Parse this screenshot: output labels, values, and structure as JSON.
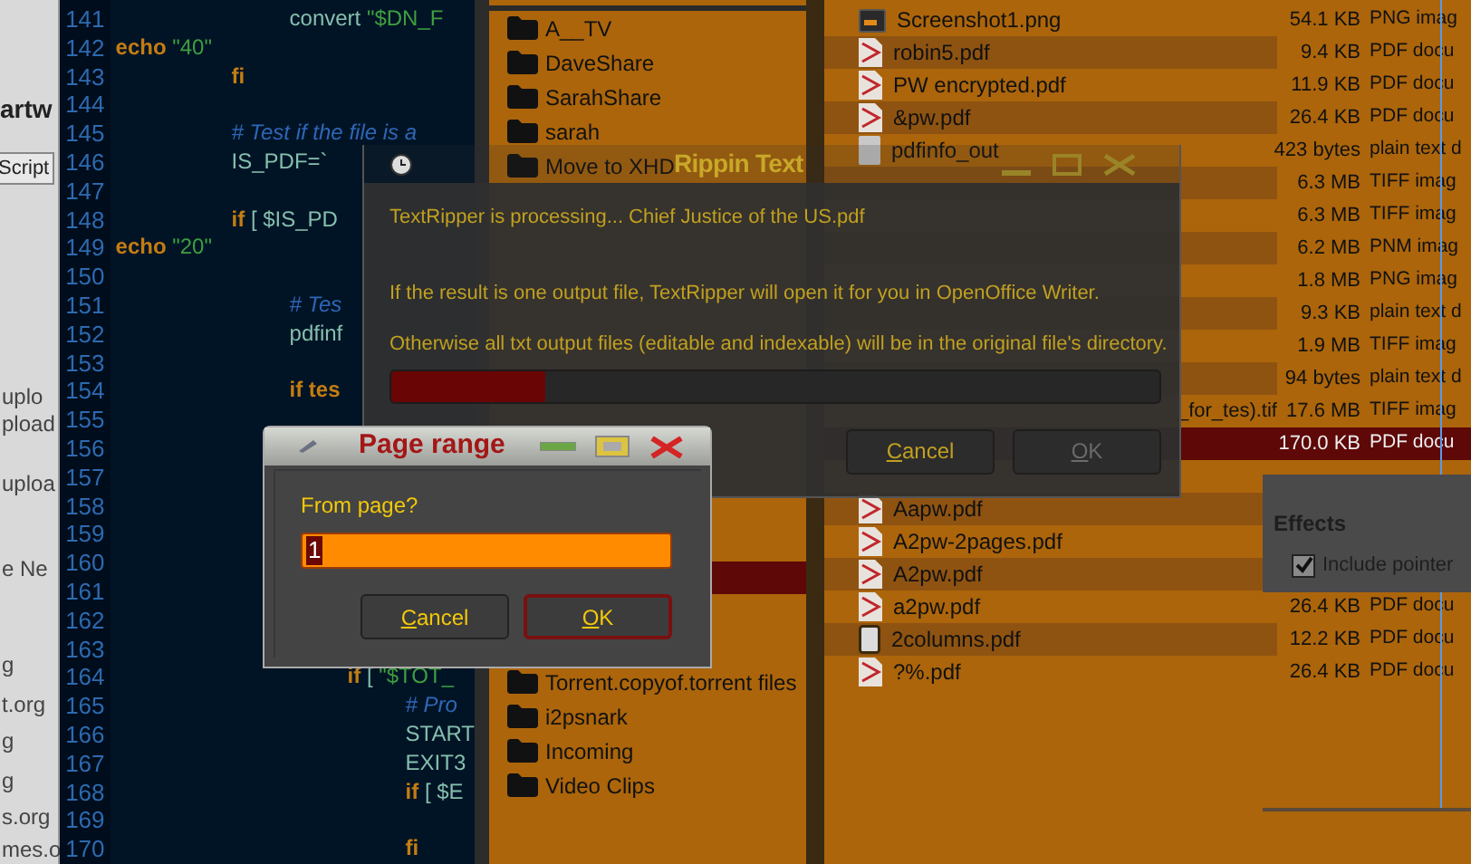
{
  "browser_window": {
    "heading": "artw",
    "button": "Script",
    "fragments": [
      "uplo",
      "pload",
      "uploa",
      "e Ne",
      "g",
      "t.org",
      "g",
      "g",
      "s.org",
      "mes.o"
    ]
  },
  "editor": {
    "lines": [
      {
        "number": "141",
        "tokens": [
          {
            "kind": "plain",
            "text": "\t\t\tconvert "
          },
          {
            "kind": "string",
            "text": "\"$DN_F"
          }
        ]
      },
      {
        "number": "142",
        "tokens": [
          {
            "kind": "keyword",
            "text": "echo "
          },
          {
            "kind": "string",
            "text": "\"40\""
          }
        ]
      },
      {
        "number": "143",
        "tokens": [
          {
            "kind": "keyword",
            "text": "\t\tfi"
          }
        ]
      },
      {
        "number": "144"
      },
      {
        "number": "145",
        "tokens": [
          {
            "kind": "comment",
            "text": "\t\t# Test if the file is a"
          }
        ]
      },
      {
        "number": "146",
        "tokens": [
          {
            "kind": "plain",
            "text": "\t\tIS_PDF=`"
          }
        ]
      },
      {
        "number": "147"
      },
      {
        "number": "148",
        "tokens": [
          {
            "kind": "keyword",
            "text": "\t\tif"
          },
          {
            "kind": "plain",
            "text": " [ $IS_PD"
          }
        ]
      },
      {
        "number": "149",
        "tokens": [
          {
            "kind": "keyword",
            "text": "echo "
          },
          {
            "kind": "string",
            "text": "\"20\""
          }
        ]
      },
      {
        "number": "150"
      },
      {
        "number": "151",
        "tokens": [
          {
            "kind": "comment",
            "text": "\t\t\t# Tes"
          }
        ]
      },
      {
        "number": "152",
        "tokens": [
          {
            "kind": "plain",
            "text": "\t\t\tpdfinf"
          }
        ]
      },
      {
        "number": "153"
      },
      {
        "number": "154",
        "tokens": [
          {
            "kind": "keyword",
            "text": "\t\t\tif tes"
          }
        ]
      },
      {
        "number": "155"
      },
      {
        "number": "156"
      },
      {
        "number": "157"
      },
      {
        "number": "158"
      },
      {
        "number": "159"
      },
      {
        "number": "160"
      },
      {
        "number": "161"
      },
      {
        "number": "162"
      },
      {
        "number": "163"
      },
      {
        "number": "164",
        "tokens": [
          {
            "kind": "keyword",
            "text": "\t\t\t\tif"
          },
          {
            "kind": "plain",
            "text": " [ "
          },
          {
            "kind": "string",
            "text": "\"$TOT_"
          }
        ]
      },
      {
        "number": "165",
        "tokens": [
          {
            "kind": "comment",
            "text": "\t\t\t\t\t# Pro"
          }
        ]
      },
      {
        "number": "166",
        "tokens": [
          {
            "kind": "plain",
            "text": "\t\t\t\t\tSTART"
          }
        ]
      },
      {
        "number": "167",
        "tokens": [
          {
            "kind": "plain",
            "text": "\t\t\t\t\tEXIT3"
          }
        ]
      },
      {
        "number": "168",
        "tokens": [
          {
            "kind": "keyword",
            "text": "\t\t\t\t\tif"
          },
          {
            "kind": "plain",
            "text": " [ $E"
          }
        ]
      },
      {
        "number": "169"
      },
      {
        "number": "170",
        "tokens": [
          {
            "kind": "keyword",
            "text": "\t\t\t\t\tfi"
          }
        ]
      }
    ]
  },
  "file_manager": {
    "folders_top": [
      "A__TV",
      "DaveShare",
      "SarahShare",
      "sarah",
      "Move to XHD"
    ],
    "folders_bottom": [
      "Torrent.copyof.torrent files",
      "i2psnark",
      "Incoming",
      "Video Clips"
    ],
    "files": [
      {
        "kind": "image",
        "name": "Screenshot1.png",
        "size": "54.1 KB",
        "type": "PNG imag",
        "selected": false
      },
      {
        "kind": "pdf",
        "name": "robin5.pdf",
        "size": "9.4 KB",
        "type": "PDF docu",
        "selected": false
      },
      {
        "kind": "pdf",
        "name": "PW encrypted.pdf",
        "size": "11.9 KB",
        "type": "PDF docu",
        "selected": false
      },
      {
        "kind": "pdf",
        "name": "&pw.pdf",
        "size": "26.4 KB",
        "type": "PDF docu",
        "selected": false
      },
      {
        "kind": "text",
        "name": "pdfinfo_out",
        "size": "423 bytes",
        "type": "plain text d",
        "selected": false
      },
      {
        "kind": "hidden",
        "size": "6.3 MB",
        "type": "TIFF imag",
        "selected": false
      },
      {
        "kind": "hidden",
        "size": "6.3 MB",
        "type": "TIFF imag",
        "selected": false
      },
      {
        "kind": "hidden",
        "size": "6.2 MB",
        "type": "PNM imag",
        "selected": false
      },
      {
        "kind": "hidden",
        "size": "1.8 MB",
        "type": "PNG imag",
        "selected": false
      },
      {
        "kind": "hidden",
        "size": "9.3 KB",
        "type": "plain text d",
        "selected": false
      },
      {
        "kind": "hidden",
        "size": "1.9 MB",
        "type": "TIFF imag",
        "selected": false
      },
      {
        "kind": "hidden",
        "size": "94 bytes",
        "type": "plain text d",
        "selected": false
      },
      {
        "kind": "hidden",
        "name": "_for_tes).tif",
        "size": "17.6 MB",
        "type": "TIFF imag",
        "selected": false
      },
      {
        "kind": "hidden",
        "size": "170.0 KB",
        "type": "PDF docu",
        "selected": true
      },
      {
        "kind": "hidden",
        "selected": false
      },
      {
        "kind": "pdf",
        "name": "Aapw.pdf",
        "selected": false
      },
      {
        "kind": "pdf",
        "name": "A2pw-2pages.pdf",
        "selected": false
      },
      {
        "kind": "pdf",
        "name": "A2pw.pdf",
        "selected": false
      },
      {
        "kind": "pdf",
        "name": "a2pw.pdf",
        "size": "26.4 KB",
        "type": "PDF docu",
        "selected": false
      },
      {
        "kind": "doc",
        "name": "2columns.pdf",
        "size": "12.2 KB",
        "type": "PDF docu",
        "selected": false
      },
      {
        "kind": "pdf",
        "name": "?%.pdf",
        "size": "26.4 KB",
        "type": "PDF docu",
        "selected": false
      }
    ]
  },
  "effects_panel": {
    "heading": "Effects",
    "checkbox": {
      "label": "Include pointer",
      "checked": true
    }
  },
  "rippin_dialog": {
    "title": "Rippin Text",
    "messages": [
      "TextRipper is processing... Chief Justice of the US.pdf",
      "If the result is one output file, TextRipper will open it for you in OpenOffice Writer.",
      "Otherwise all txt output files (editable and indexable) will be in the original file's directory."
    ],
    "progress": {
      "level": 0.2
    },
    "buttons": [
      {
        "label": "Cancel",
        "disabled": false
      },
      {
        "label": "OK",
        "disabled": true
      }
    ]
  },
  "page_range_dialog": {
    "title": "Page range",
    "prompt": "From page?",
    "input": {
      "value": "1",
      "value_selected": true
    },
    "buttons": [
      {
        "label": "Cancel",
        "default": false
      },
      {
        "label": "OK",
        "default": true
      }
    ]
  }
}
